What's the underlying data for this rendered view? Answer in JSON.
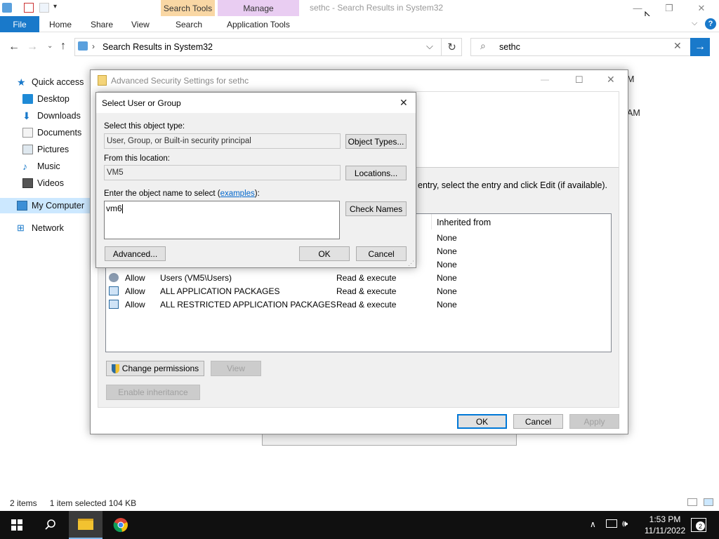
{
  "explorer": {
    "title": "sethc - Search Results in System32",
    "context_tabs": {
      "search_tools": "Search Tools",
      "manage": "Manage"
    },
    "ribbon_tabs": [
      "File",
      "Home",
      "Share",
      "View",
      "Search",
      "Application Tools"
    ],
    "address": "Search Results in System32",
    "search_value": "sethc",
    "nav_items": [
      "Quick access",
      "Desktop",
      "Downloads",
      "Documents",
      "Pictures",
      "Music",
      "Videos",
      "My Computer",
      "Network"
    ],
    "status": {
      "items": "2 items",
      "selected": "1 item selected  104 KB"
    },
    "bg_fragment_1": "M",
    "bg_fragment_2": "AM"
  },
  "advanced_security": {
    "title": "Advanced Security Settings for sethc",
    "instruction_fragment": "entry, select the entry and click Edit (if available).",
    "col_inherited": "Inherited from",
    "rows": [
      {
        "type": "",
        "principal": "",
        "access": "",
        "inherited": "None"
      },
      {
        "type": "",
        "principal": "",
        "access": "",
        "inherited": "None"
      },
      {
        "type": "",
        "principal": "",
        "access": "",
        "inherited": "None"
      },
      {
        "type": "Allow",
        "principal": "Users (VM5\\Users)",
        "access": "Read & execute",
        "inherited": "None"
      },
      {
        "type": "Allow",
        "principal": "ALL APPLICATION PACKAGES",
        "access": "Read & execute",
        "inherited": "None"
      },
      {
        "type": "Allow",
        "principal": "ALL RESTRICTED APPLICATION PACKAGES",
        "access": "Read & execute",
        "inherited": "None"
      }
    ],
    "change_permissions": "Change permissions",
    "view": "View",
    "enable_inheritance": "Enable inheritance",
    "ok": "OK",
    "cancel": "Cancel",
    "apply": "Apply"
  },
  "select_user": {
    "title": "Select User or Group",
    "object_type_label": "Select this object type:",
    "object_type_value": "User, Group, or Built-in security principal",
    "object_types_btn": "Object Types...",
    "location_label": "From this location:",
    "location_value": "VM5",
    "locations_btn": "Locations...",
    "name_label_prefix": "Enter the object name to select (",
    "name_label_link": "examples",
    "name_label_suffix": "):",
    "name_value": "vm6",
    "check_names_btn": "Check Names",
    "advanced_btn": "Advanced...",
    "ok": "OK",
    "cancel": "Cancel"
  },
  "taskbar": {
    "time": "1:53 PM",
    "date": "11/11/2022",
    "notification_count": "2"
  },
  "colors": {
    "accent": "#1979ca",
    "search_tools_tab": "#f9d7a4",
    "manage_tab": "#e9cdf2",
    "taskbar": "#101010"
  }
}
